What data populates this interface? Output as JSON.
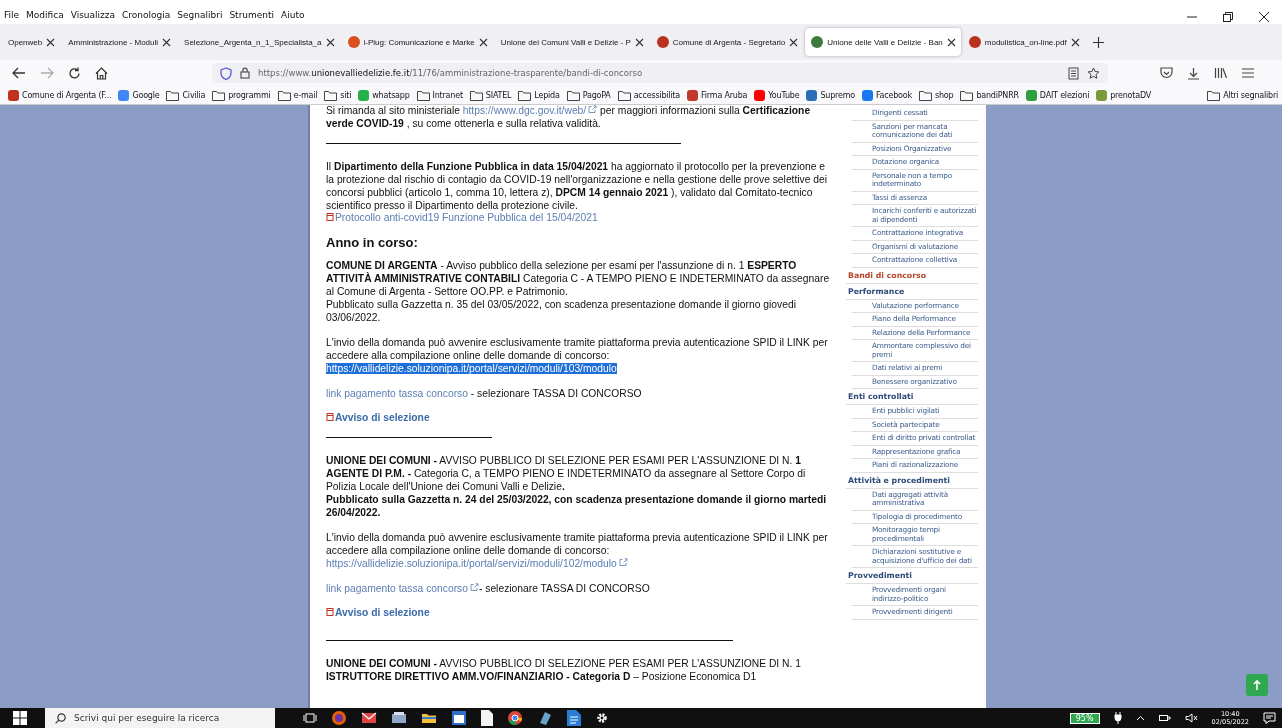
{
  "menu": [
    "File",
    "Modifica",
    "Visualizza",
    "Cronologia",
    "Segnalibri",
    "Strumenti",
    "Aiuto"
  ],
  "tabs": [
    {
      "title": "Openweb",
      "selected": false
    },
    {
      "title": "Amministrazione - Moduli",
      "selected": false
    },
    {
      "title": "Selezione_Argenta_n_1_Specialista_a",
      "selected": false
    },
    {
      "title": "i-Plug: Comunicazione e Marke",
      "selected": false,
      "color": "#d9501e"
    },
    {
      "title": "Unione dei Comuni Valli e Delizie - P",
      "selected": false
    },
    {
      "title": "Comune di Argenta - Segretario",
      "selected": false,
      "color": "#b8321e"
    },
    {
      "title": "Unione delle Valli e Delizie - Ban",
      "selected": true,
      "color": "#3d7a3d"
    },
    {
      "title": "modulistica_on-line.pdf",
      "selected": false,
      "color": "#b8321e"
    }
  ],
  "address": {
    "scheme": "https://www.",
    "domain": "unionevalliedelizie.fe.it",
    "path": "/11/76/amministrazione-trasparente/bandi-di-concorso"
  },
  "bookmarks": [
    {
      "label": "Comune di Argenta (F...",
      "kind": "site",
      "color": "#c0321e"
    },
    {
      "label": "Google",
      "kind": "site",
      "color": "#4285f4"
    },
    {
      "label": "Civilia",
      "kind": "folder"
    },
    {
      "label": "programmi",
      "kind": "folder"
    },
    {
      "label": "e-mail",
      "kind": "folder"
    },
    {
      "label": "siti",
      "kind": "folder"
    },
    {
      "label": "whatsapp",
      "kind": "site",
      "color": "#25b04a"
    },
    {
      "label": "Intranet",
      "kind": "folder"
    },
    {
      "label": "SIATEL",
      "kind": "folder"
    },
    {
      "label": "Lepida",
      "kind": "folder"
    },
    {
      "label": "PagoPA",
      "kind": "folder"
    },
    {
      "label": "accessibilita",
      "kind": "folder"
    },
    {
      "label": "Firma Aruba",
      "kind": "site",
      "color": "#c0392b"
    },
    {
      "label": "YouTube",
      "kind": "site",
      "color": "#ff0000"
    },
    {
      "label": "Supremo",
      "kind": "site",
      "color": "#2a6fb5"
    },
    {
      "label": "Facebook",
      "kind": "site",
      "color": "#1877f2"
    },
    {
      "label": "shop",
      "kind": "folder"
    },
    {
      "label": "bandiPNRR",
      "kind": "folder"
    },
    {
      "label": "DAIT elezioni",
      "kind": "site",
      "color": "#2e9e3e"
    },
    {
      "label": "prenotaDV",
      "kind": "site",
      "color": "#7a9a3a"
    }
  ],
  "other_bookmarks": "Altri segnalibri",
  "content": [
    {
      "kind": "para",
      "parts": [
        {
          "kind": "text",
          "text": "Si rimanda al sito ministeriale "
        },
        {
          "kind": "link",
          "text": "https://www.dgc.gov.it/web/",
          "external": true
        },
        {
          "kind": "text",
          "text": " per maggiori informazioni sulla **Certificazione verde COVID-19** , su come ottenerla e sulla relativa validità."
        }
      ]
    },
    {
      "kind": "rule_long"
    },
    {
      "kind": "para",
      "parts": [
        {
          "kind": "text",
          "text": "Il **Dipartimento della Funzione Pubblica in data 15/04/2021** ha aggiornato il protocollo per la prevenzione e la protezione dal rischio di contagio da COVID-19 nell'organizzazione e nella gestione delle prove selettive dei concorsi pubblici (articolo 1, comma 10, lettera z), **DPCM 14 gennaio 2021** ), validato dal Comitato-tecnico scientifico presso il Dipartimento della protezione civile."
        },
        {
          "kind": "break"
        },
        {
          "kind": "file",
          "text": "Protocollo anti-covid19 Funzione Pubblica del 15/04/2021",
          "bold": false
        }
      ]
    },
    {
      "kind": "heading",
      "text": "Anno in corso:"
    },
    {
      "kind": "para",
      "parts": [
        {
          "kind": "text",
          "text": "**COMUNE DI ARGENTA** - Avviso pubblico della selezione per esami per l'assunzione di n. 1   **ESPERTO ATTIVITÀ AMMINISTRATIVE CONTABILI** Categoria C - A TEMPO PIENO E INDETERMINATO da assegnare al Comune di Argenta  - Settore OO.PP. e Patrimonio."
        },
        {
          "kind": "break"
        },
        {
          "kind": "text",
          "text": "Pubblicato sulla Gazzetta n. 35 del 03/05/2022, con scadenza presentazione domande il giorno giovedi 03/06/2022."
        }
      ]
    },
    {
      "kind": "para",
      "parts": [
        {
          "kind": "text",
          "text": "L'invio della domanda può avvenire esclusivamente tramite piattaforma previa autenticazione SPID il LINK per accedere alla compilazione online delle domande di concorso:"
        },
        {
          "kind": "break"
        },
        {
          "kind": "link",
          "text": "https://vallidelizie.soluzionipa.it/portal/servizi/moduli/103/modulo",
          "external": false,
          "highlighted": true
        }
      ]
    },
    {
      "kind": "para",
      "parts": [
        {
          "kind": "link",
          "text": "link pagamento tassa concorso",
          "external": false
        },
        {
          "kind": "text",
          "text": " - selezionare TASSA DI CONCORSO"
        }
      ]
    },
    {
      "kind": "para",
      "parts": [
        {
          "kind": "file",
          "text": "Avviso di selezione",
          "bold": true
        }
      ]
    },
    {
      "kind": "rule_short"
    },
    {
      "kind": "para",
      "parts": [
        {
          "kind": "text",
          "text": "**UNIONE DEI COMUNI -** AVVISO PUBBLICO DI SELEZIONE PER ESAMI PER L'ASSUNZIONE DI N. **1 AGENTE DI P.M. -** Categoria C, a TEMPO PIENO E INDETERMINATO da assegnare al Settore Corpo di Polizia Locale dell'Unione dei Comuni Valli e Delizie**.**"
        },
        {
          "kind": "break"
        },
        {
          "kind": "text",
          "text": "**Pubblicato sulla Gazzetta n. 24 del 25/03/2022, con scadenza presentazione domande il giorno martedi 26/04/2022.**"
        }
      ]
    },
    {
      "kind": "para",
      "parts": [
        {
          "kind": "text",
          "text": "L'invio della domanda può avvenire esclusivamente tramite piattaforma previa autenticazione SPID il LINK per accedere alla compilazione online delle domande di concorso:"
        },
        {
          "kind": "break"
        },
        {
          "kind": "link",
          "text": "https://vallidelizie.soluzionipa.it/portal/servizi/moduli/102/modulo",
          "external": true
        }
      ]
    },
    {
      "kind": "para",
      "parts": [
        {
          "kind": "link",
          "text": "link pagamento tassa concorso",
          "external": true
        },
        {
          "kind": "text",
          "text": "- selezionare TASSA DI CONCORSO"
        }
      ]
    },
    {
      "kind": "para",
      "parts": [
        {
          "kind": "file",
          "text": "Avviso di selezione",
          "bold": true
        }
      ]
    },
    {
      "kind": "rule_full"
    },
    {
      "kind": "para",
      "parts": [
        {
          "kind": "text",
          "text": "**UNIONE DEI COMUNI -** AVVISO PUBBLICO DI SELEZIONE PER ESAMI PER L'ASSUNZIONE DI N. 1"
        },
        {
          "kind": "break"
        },
        {
          "kind": "text",
          "text": "**ISTRUTTORE DIRETTIVO AMM.VO/FINANZIARIO - Categoria D** – Posizione Economica D1"
        }
      ]
    }
  ],
  "sidebar": {
    "continued_items": [
      {
        "label": "Dirigenti cessati",
        "selected": false
      },
      {
        "label": "Sanzioni per mancata comunicazione dei dati",
        "selected": false
      },
      {
        "label": "Posizioni Organizzative",
        "selected": false
      },
      {
        "label": "Dotazione organica",
        "selected": false
      },
      {
        "label": "Personale non a tempo indeterminato",
        "selected": false
      },
      {
        "label": "Tassi di assenza",
        "selected": false
      },
      {
        "label": "Incarichi conferiti e autorizzati ai dipendenti",
        "selected": false
      },
      {
        "label": "Contrattazione integrativa",
        "selected": false
      },
      {
        "label": "Organismi di valutazione",
        "selected": false
      },
      {
        "label": "Contrattazione collettiva",
        "selected": false
      }
    ],
    "items": [
      {
        "label": "Bandi di concorso",
        "selected": true
      },
      {
        "label": "Performance",
        "selected": false,
        "children": [
          {
            "label": "Valutazione performance",
            "selected": false
          },
          {
            "label": "Piano della Performance",
            "selected": false
          },
          {
            "label": "Relazione della Performance",
            "selected": false
          },
          {
            "label": "Ammontare complessivo dei premi",
            "selected": false
          },
          {
            "label": "Dati relativi ai premi",
            "selected": false
          },
          {
            "label": "Benessere organizzativo",
            "selected": false
          }
        ]
      },
      {
        "label": "Enti controllati",
        "selected": false,
        "children": [
          {
            "label": "Enti pubblici vigilati",
            "selected": false
          },
          {
            "label": "Società partecipate",
            "selected": false
          },
          {
            "label": "Enti di diritto privati controllat",
            "selected": false
          },
          {
            "label": "Rappresentazione grafica",
            "selected": false
          },
          {
            "label": "Piani di razionalizzazione",
            "selected": false
          }
        ]
      },
      {
        "label": "Attività e procedimenti",
        "selected": false,
        "children": [
          {
            "label": "Dati aggregati attività amministrativa",
            "selected": false
          },
          {
            "label": "Tipologia di procedimento",
            "selected": false
          },
          {
            "label": "Monitoraggio tempi procedimentali",
            "selected": false
          },
          {
            "label": "Dichiarazioni sostitutive e acquisizione d'ufficio dei dati",
            "selected": false
          }
        ]
      },
      {
        "label": "Provvedimenti",
        "selected": false,
        "children": [
          {
            "label": "Provvedimenti organi indirizzo-politico",
            "selected": false
          },
          {
            "label": "Provvedimenti dirigenti",
            "selected": false
          }
        ]
      }
    ]
  },
  "taskbar": {
    "search_placeholder": "Scrivi qui per eseguire la ricerca",
    "battery": "95%",
    "time": "10:40",
    "date": "02/05/2022"
  }
}
